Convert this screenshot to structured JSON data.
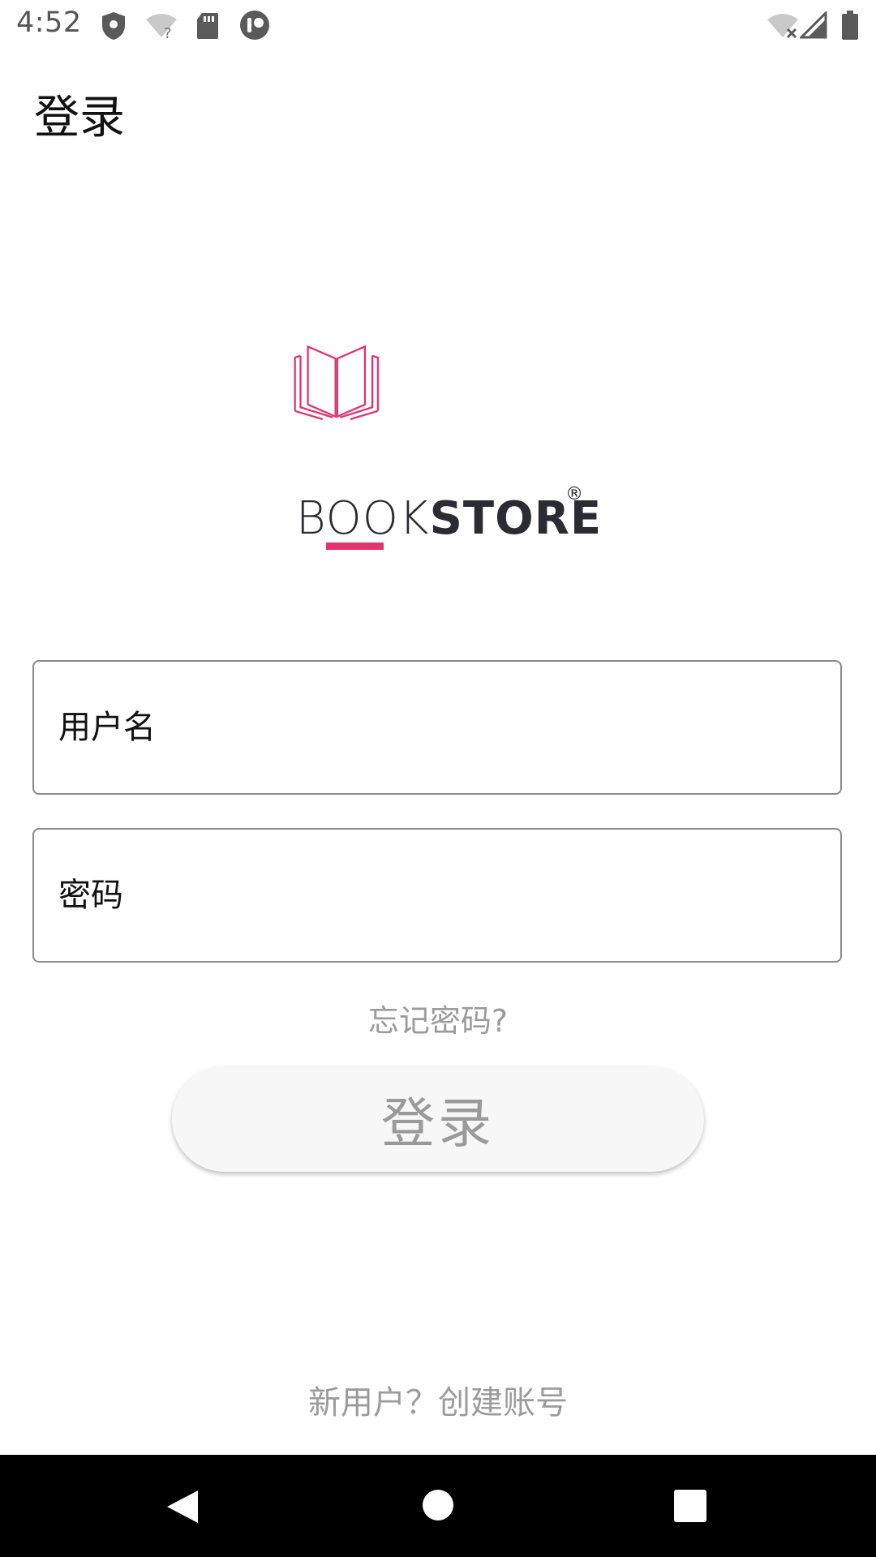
{
  "status_bar": {
    "time": "4:52",
    "left_icons": [
      "shield-icon",
      "wifi-question-icon",
      "sd-card-icon",
      "app-notification-icon"
    ],
    "right_icons": [
      "wifi-off-icon",
      "cellular-signal-icon",
      "battery-icon"
    ]
  },
  "header": {
    "title": "登录"
  },
  "logo": {
    "word_light": "BOO",
    "word_mid": "K",
    "word_bold": "STORE",
    "registered": "®",
    "accent_color": "#e5316f",
    "text_color": "#2b2b33"
  },
  "form": {
    "username": {
      "placeholder": "用户名",
      "value": ""
    },
    "password": {
      "placeholder": "密码",
      "value": ""
    },
    "forgot_password": "忘记密码?",
    "login_button": "登录"
  },
  "footer": {
    "signup_link": "新用户？创建账号"
  },
  "nav_bar": {
    "icons": [
      "back-icon",
      "home-icon",
      "recents-icon"
    ]
  }
}
